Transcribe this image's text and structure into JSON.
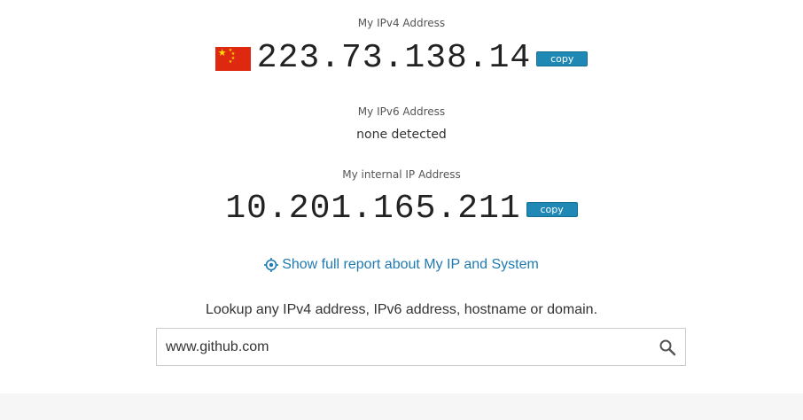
{
  "ipv4": {
    "caption": "My IPv4 Address",
    "address": "223.73.138.14",
    "flag_icon": "china-flag-icon",
    "copy_label": "copy"
  },
  "ipv6": {
    "caption": "My IPv6 Address",
    "value": "none detected"
  },
  "internal": {
    "caption": "My internal IP Address",
    "address": "10.201.165.211",
    "copy_label": "copy"
  },
  "report": {
    "icon": "target-icon",
    "label": "Show full report about My IP and System"
  },
  "lookup": {
    "label": "Lookup any IPv4 address, IPv6 address, hostname or domain.",
    "input_value": "www.github.com",
    "search_icon": "search-icon"
  },
  "colors": {
    "accent": "#1f88b4",
    "link": "#1f7ab0",
    "flag_red": "#de2910",
    "flag_yellow": "#ffde00"
  }
}
